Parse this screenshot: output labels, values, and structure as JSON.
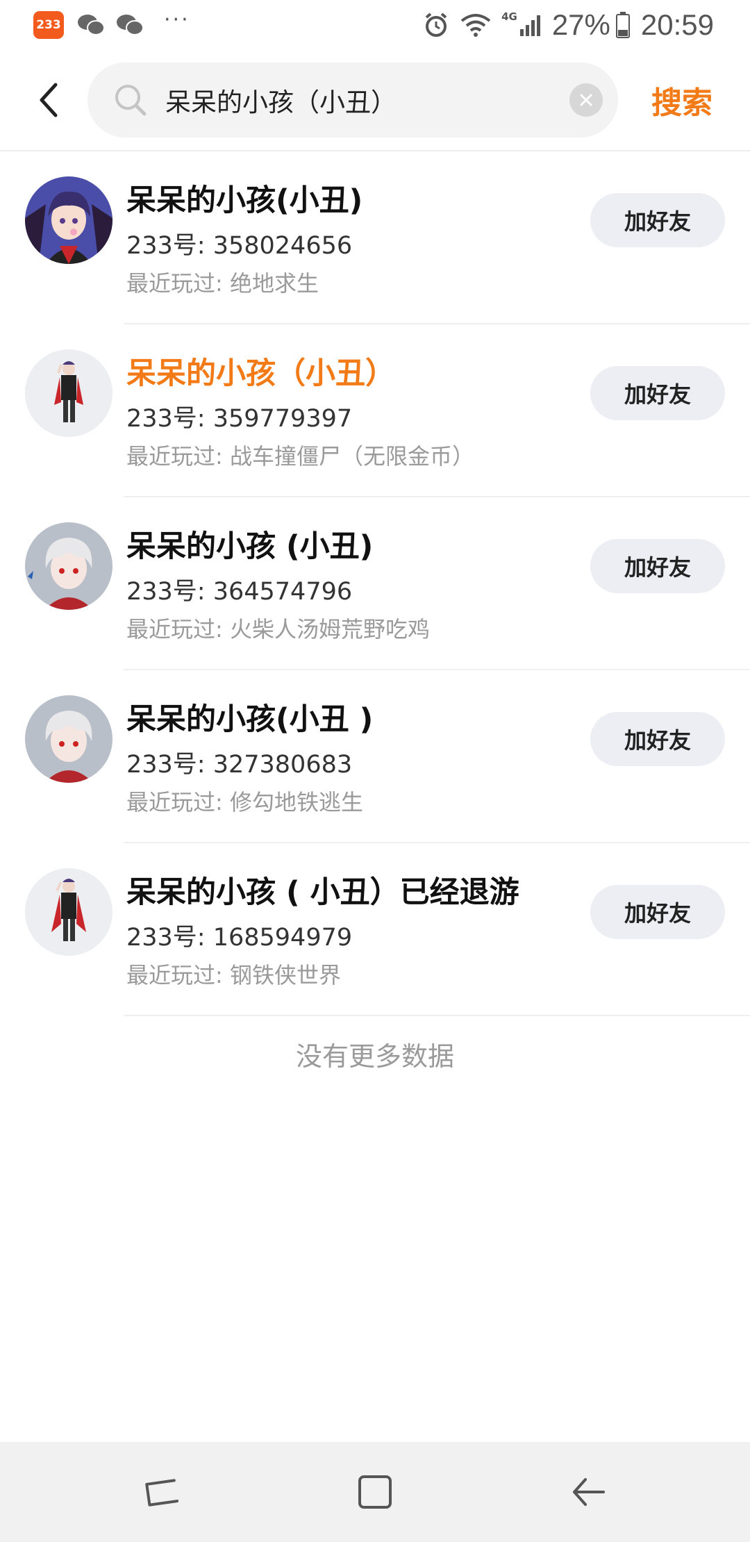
{
  "status_bar": {
    "app_badge": "233",
    "battery": "27%",
    "time": "20:59",
    "network": "4G",
    "more": "···"
  },
  "search": {
    "query": "呆呆的小孩（小丑）",
    "placeholder": "",
    "submit_label": "搜索"
  },
  "results": [
    {
      "name": "呆呆的小孩(小丑)",
      "uid": "233号: 358024656",
      "played": "最近玩过: 绝地求生",
      "button": "加好友"
    },
    {
      "name": "呆呆的小孩（小丑）",
      "uid": "233号: 359779397",
      "played": "最近玩过: 战车撞僵尸（无限金币）",
      "button": "加好友"
    },
    {
      "name": "呆呆的小孩 (小丑)",
      "uid": "233号: 364574796",
      "played": "最近玩过: 火柴人汤姆荒野吃鸡",
      "button": "加好友"
    },
    {
      "name": "呆呆的小孩(小丑 )",
      "uid": "233号: 327380683",
      "played": "最近玩过: 修勾地铁逃生",
      "button": "加好友"
    },
    {
      "name": "呆呆的小孩 ( 小丑）已经退游",
      "uid": "233号: 168594979",
      "played": "最近玩过: 钢铁侠世界",
      "button": "加好友"
    }
  ],
  "footer_text": "没有更多数据",
  "colors": {
    "accent": "#f27b18",
    "badge": "#f25a1e"
  }
}
